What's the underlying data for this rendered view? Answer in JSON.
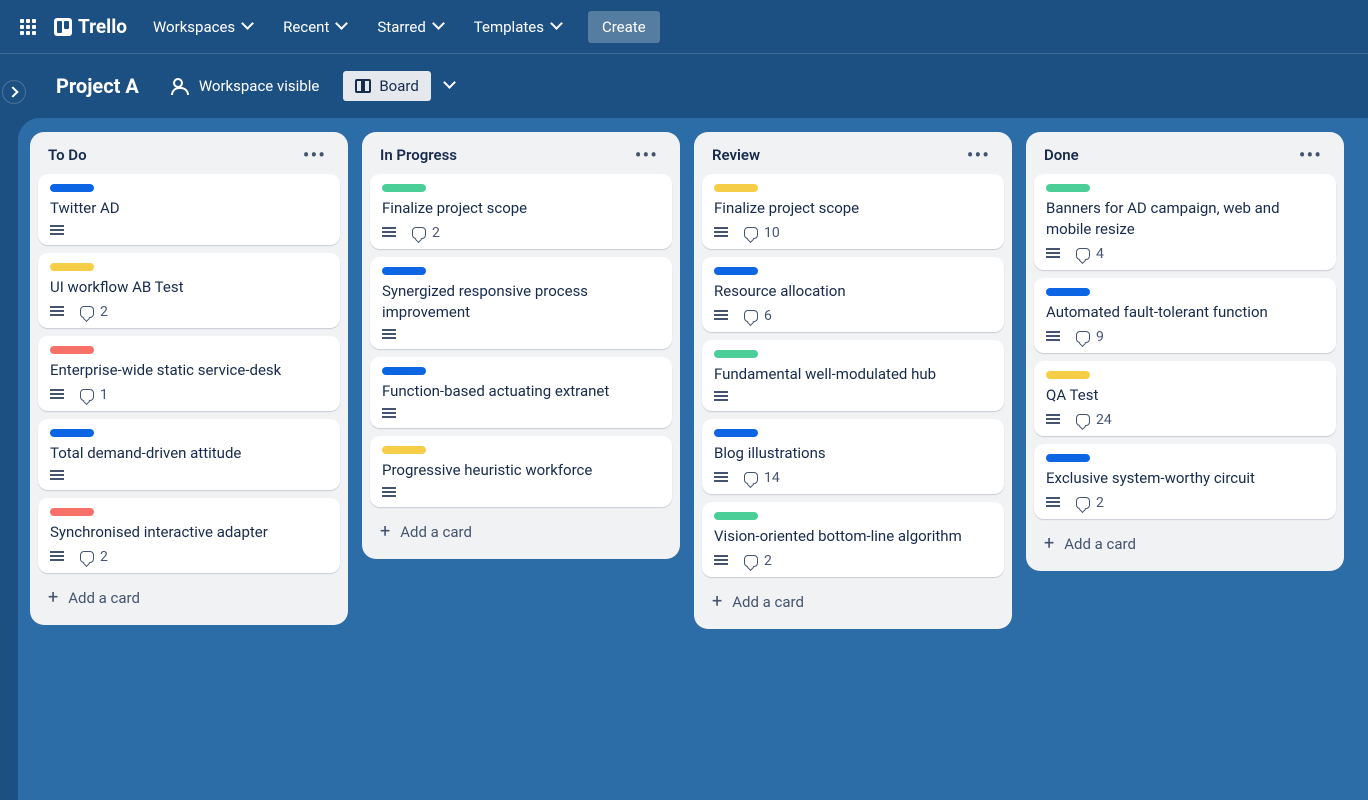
{
  "app": {
    "name": "Trello"
  },
  "topnav": {
    "items": [
      "Workspaces",
      "Recent",
      "Starred",
      "Templates"
    ],
    "create": "Create"
  },
  "board": {
    "title": "Project A",
    "visibility": "Workspace visible",
    "view_switcher": "Board"
  },
  "labels": {
    "blue": "#0c66e4",
    "green": "#4bce97",
    "yellow": "#f5cd47",
    "red": "#f87168"
  },
  "add_card_label": "Add a card",
  "lists": [
    {
      "title": "To Do",
      "cards": [
        {
          "label": "blue",
          "title": "Twitter AD",
          "has_desc": true
        },
        {
          "label": "yellow",
          "title": "UI workflow AB Test",
          "has_desc": true,
          "comments": 2
        },
        {
          "label": "red",
          "title": "Enterprise-wide static service-desk",
          "has_desc": true,
          "comments": 1
        },
        {
          "label": "blue",
          "title": "Total demand-driven attitude",
          "has_desc": true
        },
        {
          "label": "red",
          "title": "Synchronised interactive adapter",
          "has_desc": true,
          "comments": 2
        }
      ]
    },
    {
      "title": "In Progress",
      "cards": [
        {
          "label": "green",
          "title": "Finalize project scope",
          "has_desc": true,
          "comments": 2
        },
        {
          "label": "blue",
          "title": "Synergized responsive process improvement",
          "has_desc": true
        },
        {
          "label": "blue",
          "title": "Function-based actuating extranet",
          "has_desc": true
        },
        {
          "label": "yellow",
          "title": "Progressive heuristic workforce",
          "has_desc": true
        }
      ]
    },
    {
      "title": "Review",
      "cards": [
        {
          "label": "yellow",
          "title": "Finalize project scope",
          "has_desc": true,
          "comments": 10
        },
        {
          "label": "blue",
          "title": "Resource allocation",
          "has_desc": true,
          "comments": 6
        },
        {
          "label": "green",
          "title": "Fundamental well-modulated hub",
          "has_desc": true
        },
        {
          "label": "blue",
          "title": "Blog illustrations",
          "has_desc": true,
          "comments": 14
        },
        {
          "label": "green",
          "title": "Vision-oriented bottom-line algorithm",
          "has_desc": true,
          "comments": 2
        }
      ]
    },
    {
      "title": "Done",
      "cards": [
        {
          "label": "green",
          "title": "Banners for AD campaign, web and mobile resize",
          "has_desc": true,
          "comments": 4
        },
        {
          "label": "blue",
          "title": "Automated fault-tolerant function",
          "has_desc": true,
          "comments": 9
        },
        {
          "label": "yellow",
          "title": "QA Test",
          "has_desc": true,
          "comments": 24
        },
        {
          "label": "blue",
          "title": "Exclusive system-worthy circuit",
          "has_desc": true,
          "comments": 2
        }
      ]
    }
  ]
}
